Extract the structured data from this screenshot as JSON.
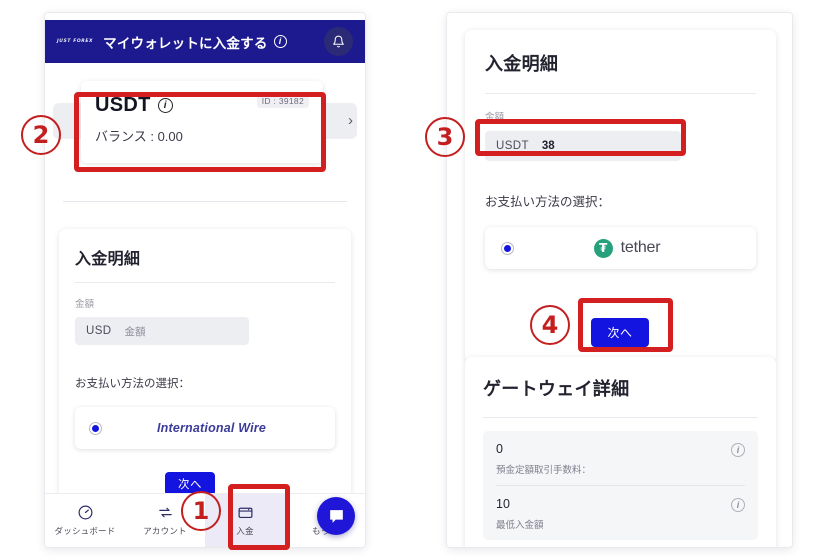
{
  "left_phone": {
    "appbar": {
      "brand": "JUST FOREX",
      "title": "マイウォレットに入金する",
      "info_icon": "info-icon",
      "bell_icon": "bell-icon"
    },
    "wallet_card": {
      "symbol": "USDT",
      "info_icon": "info-icon",
      "id_label": "ID : 39182",
      "balance": "バランス : 0.00",
      "next_chevron": "›"
    },
    "deposit_panel": {
      "title": "入金明細",
      "amount_label": "金額",
      "currency": "USD",
      "amount_placeholder": "金額",
      "payment_label": "お支払い方法の選択：",
      "method": "International Wire",
      "next_button": "次へ"
    },
    "bottom_nav": [
      {
        "label": "ダッシュボード",
        "icon": "dashboard-gauge-icon",
        "active": false
      },
      {
        "label": "アカウント",
        "icon": "account-transfer-icon",
        "active": false
      },
      {
        "label": "入金",
        "icon": "wallet-icon",
        "active": true
      },
      {
        "label": "もっと",
        "icon": "more-icon",
        "active": false
      }
    ],
    "chat_fab": "chat-bubble-icon"
  },
  "right_phone": {
    "deposit_panel": {
      "title": "入金明細",
      "amount_label": "金額",
      "currency": "USDT",
      "amount_value": "38",
      "payment_label": "お支払い方法の選択：",
      "method": "tether",
      "method_icon": "tether-logo-icon",
      "next_button": "次へ"
    },
    "gateway_panel": {
      "title": "ゲートウェイ詳細",
      "rows": [
        {
          "value": "0",
          "caption": "預金定額取引手数料：",
          "info_icon": "info-icon"
        },
        {
          "value": "10",
          "caption": "最低入金額",
          "info_icon": "info-icon"
        }
      ]
    }
  },
  "annotations": {
    "markers": [
      {
        "id": "1",
        "target": "deposit-tab"
      },
      {
        "id": "2",
        "target": "usdt-wallet-card"
      },
      {
        "id": "3",
        "target": "amount-input"
      },
      {
        "id": "4",
        "target": "next-button"
      }
    ],
    "highlight_color": "#d31f1f"
  }
}
